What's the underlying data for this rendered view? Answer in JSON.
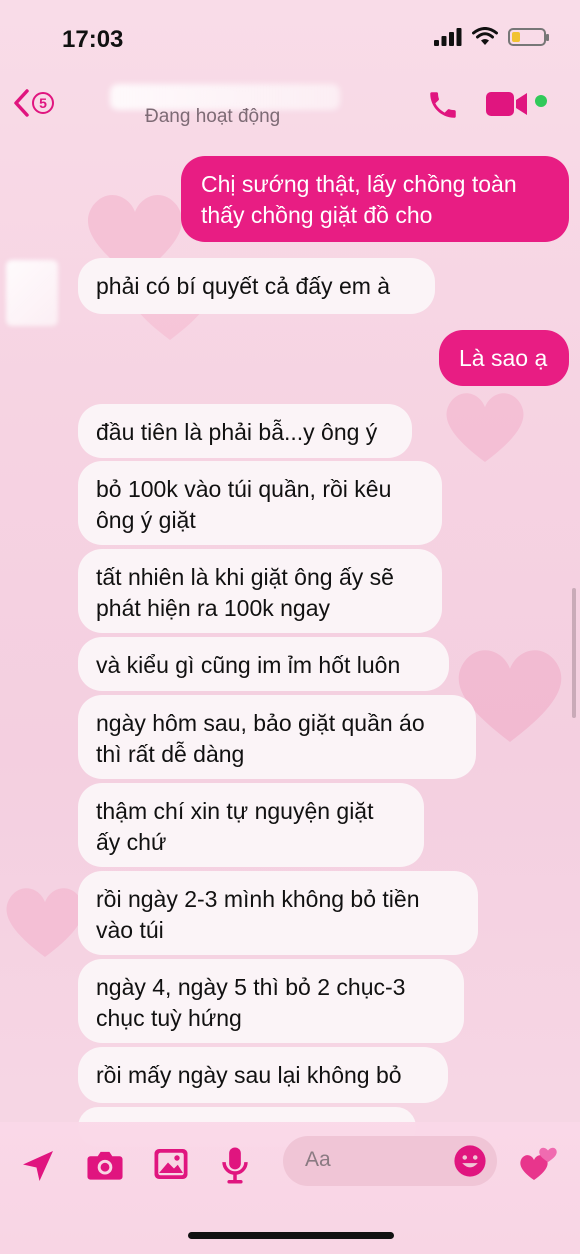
{
  "status_bar": {
    "time": "17:03",
    "battery_level": 0.25
  },
  "header": {
    "back_count": "5",
    "contact_status": "Đang hoạt động",
    "accent_color": "#e0157f",
    "online_color": "#31c95a"
  },
  "messages": [
    {
      "direction": "out",
      "text_lines": [
        "Chị sướng thật, lấy chồng toàn",
        "thấy chồng giặt đồ cho"
      ]
    },
    {
      "direction": "in",
      "text_lines": [
        "phải có bí quyết cả đấy em à"
      ]
    },
    {
      "direction": "out",
      "text_lines": [
        "Là sao ạ"
      ]
    },
    {
      "direction": "in",
      "text_lines": [
        "đầu tiên là phải bẫ...y ông ý"
      ]
    },
    {
      "direction": "in",
      "text_lines": [
        "bỏ 100k vào túi quần, rồi kêu",
        "ông ý giặt"
      ]
    },
    {
      "direction": "in",
      "text_lines": [
        "tất nhiên là khi giặt ông ấy sẽ",
        "phát hiện ra 100k ngay"
      ]
    },
    {
      "direction": "in",
      "text_lines": [
        "và kiểu gì cũng im ỉm hốt luôn"
      ]
    },
    {
      "direction": "in",
      "text_lines": [
        "ngày hôm sau, bảo giặt quần áo",
        "thì rất dễ dàng"
      ]
    },
    {
      "direction": "in",
      "text_lines": [
        "thậm chí xin tự nguyện giặt",
        "ấy chứ"
      ]
    },
    {
      "direction": "in",
      "text_lines": [
        "rồi ngày 2-3 mình không bỏ tiền",
        "vào túi"
      ]
    },
    {
      "direction": "in",
      "text_lines": [
        "ngày 4, ngày 5 thì bỏ 2 chục-3",
        "chục tuỳ hứng"
      ]
    },
    {
      "direction": "in",
      "text_lines": [
        "rồi mấy ngày sau lại không bỏ"
      ]
    }
  ],
  "composer": {
    "placeholder": "Aa",
    "icons": [
      "location-icon",
      "camera-icon",
      "image-icon",
      "microphone-icon",
      "emoji-icon",
      "hearts-icon"
    ]
  },
  "colors": {
    "outgoing_bubble": "#e81d83",
    "incoming_bubble": "#fbf4f7"
  }
}
